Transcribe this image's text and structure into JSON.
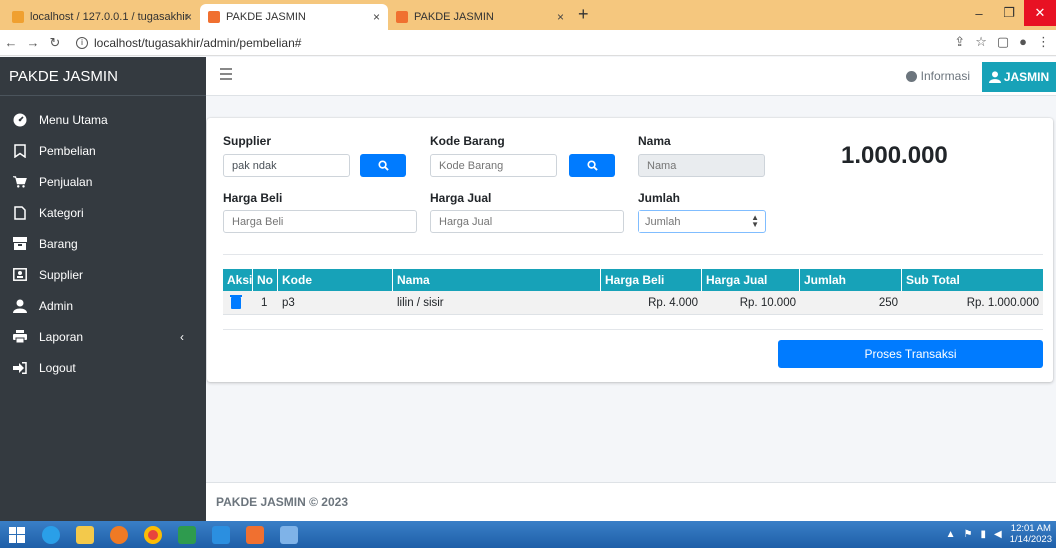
{
  "browser": {
    "tabs": [
      {
        "title": "localhost / 127.0.0.1 / tugasakhir",
        "close": "×"
      },
      {
        "title": "PAKDE JASMIN",
        "close": "×"
      },
      {
        "title": "PAKDE JASMIN",
        "close": "×"
      }
    ],
    "new_tab": "+",
    "url": "localhost/tugasakhir/admin/pembelian#",
    "window_buttons": {
      "minimize": "–",
      "maximize": "❐",
      "close": "✕"
    }
  },
  "sidebar": {
    "brand": "PAKDE JASMIN",
    "items": [
      {
        "label": "Menu Utama",
        "icon": "dashboard-icon"
      },
      {
        "label": "Pembelian",
        "icon": "bookmark-icon"
      },
      {
        "label": "Penjualan",
        "icon": "cart-icon"
      },
      {
        "label": "Kategori",
        "icon": "file-icon"
      },
      {
        "label": "Barang",
        "icon": "box-icon"
      },
      {
        "label": "Supplier",
        "icon": "contact-card-icon"
      },
      {
        "label": "Admin",
        "icon": "user-icon"
      },
      {
        "label": "Laporan",
        "icon": "print-icon"
      },
      {
        "label": "Logout",
        "icon": "sign-out-icon"
      }
    ],
    "laporan_arrow": "‹"
  },
  "navbar": {
    "info_label": "Informasi",
    "user_label": "JASMIN"
  },
  "form": {
    "supplier_label": "Supplier",
    "supplier_value": "pak ndak",
    "kode_label": "Kode Barang",
    "kode_placeholder": "Kode Barang",
    "nama_label": "Nama",
    "nama_placeholder": "Nama",
    "harga_beli_label": "Harga Beli",
    "harga_beli_placeholder": "Harga Beli",
    "harga_jual_label": "Harga Jual",
    "harga_jual_placeholder": "Harga Jual",
    "jumlah_label": "Jumlah",
    "jumlah_placeholder": "Jumlah"
  },
  "total": "1.000.000",
  "table": {
    "headers": [
      "Aksi",
      "No",
      "Kode",
      "Nama",
      "Harga Beli",
      "Harga Jual",
      "Jumlah",
      "Sub Total"
    ],
    "rows": [
      {
        "no": "1",
        "kode": "p3",
        "nama": "lilin / sisir",
        "harga_beli": "Rp. 4.000",
        "harga_jual": "Rp. 10.000",
        "jumlah": "250",
        "sub_total": "Rp. 1.000.000"
      }
    ]
  },
  "proses_button": "Proses Transaksi",
  "footer": "PAKDE JASMIN © 2023",
  "taskbar": {
    "time": "12:01 AM",
    "date": "1/14/2023"
  },
  "colors": {
    "sidebar_bg": "#343a40",
    "accent_blue": "#007bff",
    "table_header": "#17a2b8"
  }
}
